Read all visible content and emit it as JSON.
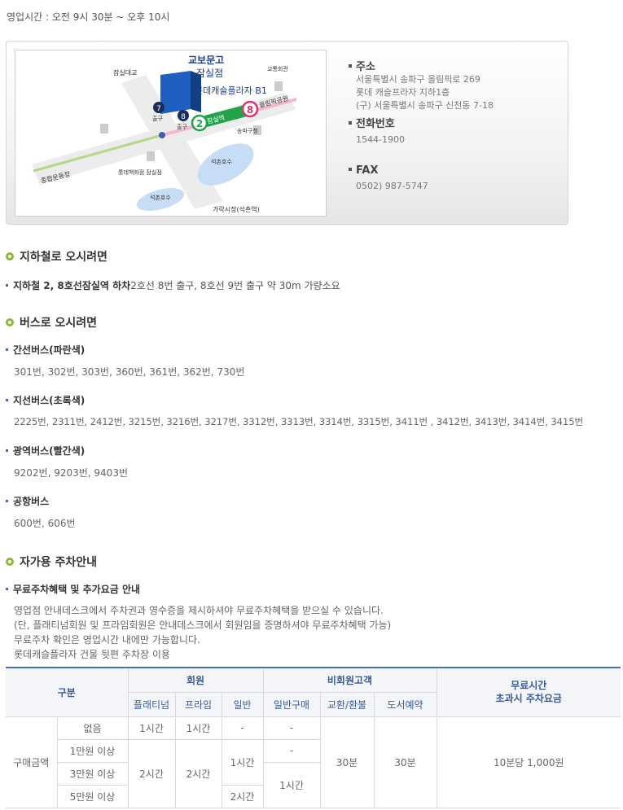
{
  "hours": "영업시간 : 오전 9시 30분 ~ 오후 10시",
  "map": {
    "store_name_1": "교보문고",
    "store_name_2": "잠실점",
    "building": "롯데캐슬플라자 B1",
    "labels": {
      "jamsil_daegyo": "잠실대교",
      "traffic_hall": "교통회관",
      "olympic_park": "올림픽공원",
      "sports_complex": "종합운동장",
      "jamsil_station": "잠실역",
      "exit_top": "출구",
      "exit_bottom": "출구",
      "songpa_office": "송파구청",
      "lotte_dept": "롯데백화점 잠실점",
      "seokchon_lake_east": "석촌호수",
      "seokchon_lake_west": "석촌호수",
      "garak_market": "가락시장(석촌역)",
      "line2": "2",
      "line8": "8",
      "exit7": "7",
      "exit8": "8"
    }
  },
  "contact": {
    "address_title": "주소",
    "address_lines": [
      "서울특별시 송파구 올림픽로 269",
      "롯데 캐슬프라자 지하1층",
      "(구) 서울특별시 송파구 신천동 7-18"
    ],
    "phone_title": "전화번호",
    "phone": "1544-1900",
    "fax_title": "FAX",
    "fax": "0502) 987-5747"
  },
  "subway": {
    "title": "지하철로 오시려면",
    "bold": "지하철 2, 8호선잠실역 하차",
    "detail": " 2호선 8번 출구, 8호선 9번 출구 약 30m 가량소요"
  },
  "bus": {
    "title": "버스로 오시려면",
    "groups": [
      {
        "name": "간선버스(파란색)",
        "routes": "301번, 302번, 303번, 360번, 361번, 362번, 730번"
      },
      {
        "name": "지선버스(초록색)",
        "routes": "2225번, 2311번, 2412번, 3215번, 3216번, 3217번, 3312번, 3313번, 3314번, 3315번, 3411번 , 3412번, 3413번, 3414번, 3415번"
      },
      {
        "name": "광역버스(빨간색)",
        "routes": "9202번, 9203번, 9403번"
      },
      {
        "name": "공항버스",
        "routes": "600번, 606번"
      }
    ]
  },
  "parking": {
    "title": "자가용 주차안내",
    "subtitle": "무료주차혜택 및 추가요금 안내",
    "lines": [
      "영업점 안내데스크에서 주차권과 영수증을 제시하셔야 무료주차혜택을 받으실 수 있습니다.",
      "(단, 플래티넘회원 및 프라임회원은 안내데스크에서 회원임을 증명하셔야 무료주차혜택 가능)",
      "무료주차 확인은 영업시간 내에만 가능합니다.",
      "롯데캐슬플라자 건물 뒷편 주차장 이용"
    ],
    "table": {
      "h_category": "구분",
      "h_member": "회원",
      "h_nonmember": "비회원고객",
      "h_overtime": "무료시간\n초과시 주차요금",
      "h_platinum": "플래티넘",
      "h_prime": "프라임",
      "h_general": "일반",
      "h_general_purchase": "일반구매",
      "h_exchange": "교환/환불",
      "h_book_reserve": "도서예약",
      "row_label": "구매금액",
      "tiers": [
        "없음",
        "1만원 이상",
        "3만원 이상",
        "5만원 이상"
      ],
      "platinum_none": "1시간",
      "prime_none": "1시간",
      "general_none": "-",
      "gp_none": "-",
      "platinum_over": "2시간",
      "prime_over": "2시간",
      "general_mid": "1시간",
      "general_5": "2시간",
      "gp_1": "-",
      "gp_3": "1시간",
      "exchange": "30분",
      "book_reserve": "30분",
      "fee": "10분당 1,000원"
    }
  }
}
